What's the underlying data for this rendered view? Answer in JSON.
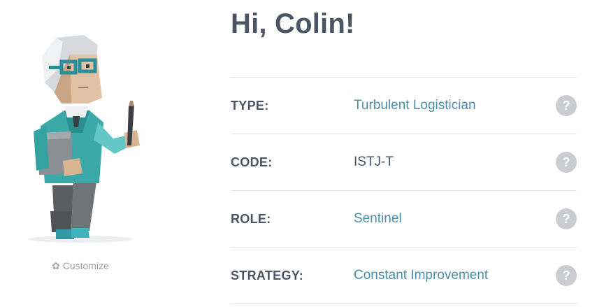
{
  "greeting": "Hi, Colin!",
  "customize": {
    "label": "Customize",
    "icon": "gear-icon"
  },
  "rows": [
    {
      "label": "TYPE:",
      "value": "Turbulent Logistician",
      "link": true
    },
    {
      "label": "CODE:",
      "value": "ISTJ-T",
      "link": false
    },
    {
      "label": "ROLE:",
      "value": "Sentinel",
      "link": true
    },
    {
      "label": "STRATEGY:",
      "value": "Constant Improvement",
      "link": true
    }
  ],
  "help_symbol": "?",
  "colors": {
    "link": "#4d8fa8",
    "text": "#4b5563",
    "help_bg": "#c9cdd1",
    "divider": "#e3e5e8"
  }
}
